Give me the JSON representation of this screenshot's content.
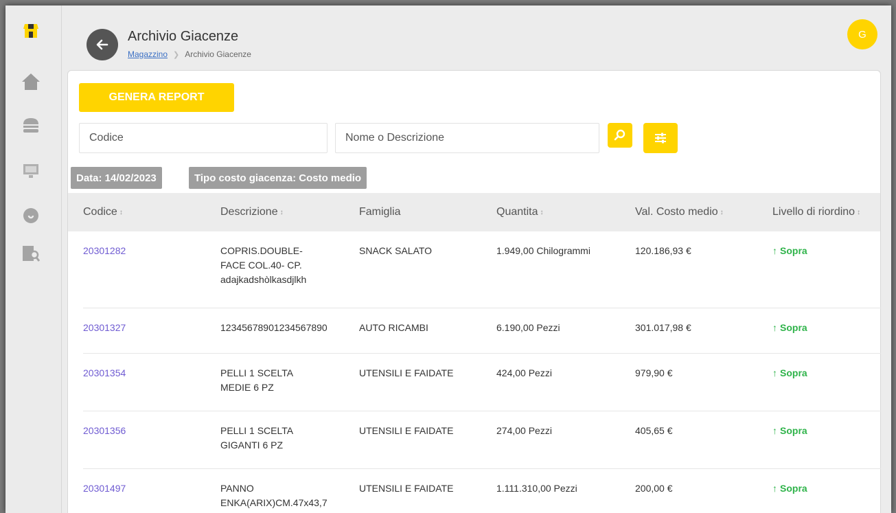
{
  "sidebar": {
    "items": [
      {
        "icon": "shop-icon"
      },
      {
        "icon": "home-icon"
      },
      {
        "icon": "burger-icon"
      },
      {
        "icon": "register-icon"
      },
      {
        "icon": "cloud-icon"
      },
      {
        "icon": "inventory-icon"
      }
    ]
  },
  "header": {
    "title": "Archivio Giacenze",
    "breadcrumb_link": "Magazzino",
    "breadcrumb_current": "Archivio Giacenze",
    "avatar_initial": "G"
  },
  "toolbar": {
    "report_label": "GENERA REPORT",
    "codice_placeholder": "Codice",
    "nome_placeholder": "Nome o Descrizione"
  },
  "chips": {
    "data": "Data: 14/02/2023",
    "tipo": "Tipo costo giacenza: Costo medio"
  },
  "table": {
    "headers": [
      "Codice",
      "Descrizione",
      "Famiglia",
      "Quantita",
      "Val. Costo medio",
      "Livello di riordino"
    ],
    "rows": [
      {
        "codice": "20301282",
        "descrizione": "COPRIS.DOUBLE-\nFACE COL.40- CP.\nadajkadshòlkasdjlkh",
        "famiglia": "SNACK SALATO",
        "quantita": "1.949,00 Chilogrammi",
        "valore": "120.186,93 €",
        "livello": "Sopra"
      },
      {
        "codice": "20301327",
        "descrizione": "12345678901234567890",
        "famiglia": "AUTO RICAMBI",
        "quantita": "6.190,00 Pezzi",
        "valore": "301.017,98 €",
        "livello": "Sopra"
      },
      {
        "codice": "20301354",
        "descrizione": "PELLI 1 SCELTA\nMEDIE 6 PZ",
        "famiglia": "UTENSILI E FAIDATE",
        "quantita": "424,00 Pezzi",
        "valore": "979,90 €",
        "livello": "Sopra"
      },
      {
        "codice": "20301356",
        "descrizione": "PELLI 1 SCELTA\nGIGANTI 6 PZ",
        "famiglia": "UTENSILI E FAIDATE",
        "quantita": "274,00 Pezzi",
        "valore": "405,65 €",
        "livello": "Sopra"
      },
      {
        "codice": "20301497",
        "descrizione": "PANNO\nENKA(ARIX)CM.47x43,7",
        "famiglia": "UTENSILI E FAIDATE",
        "quantita": "1.111.310,00 Pezzi",
        "valore": "200,00 €",
        "livello": "Sopra"
      }
    ]
  },
  "colors": {
    "accent": "#ffd400",
    "link": "#6f5bd2",
    "ok": "#2fb34a",
    "chip": "#9e9e9e"
  }
}
